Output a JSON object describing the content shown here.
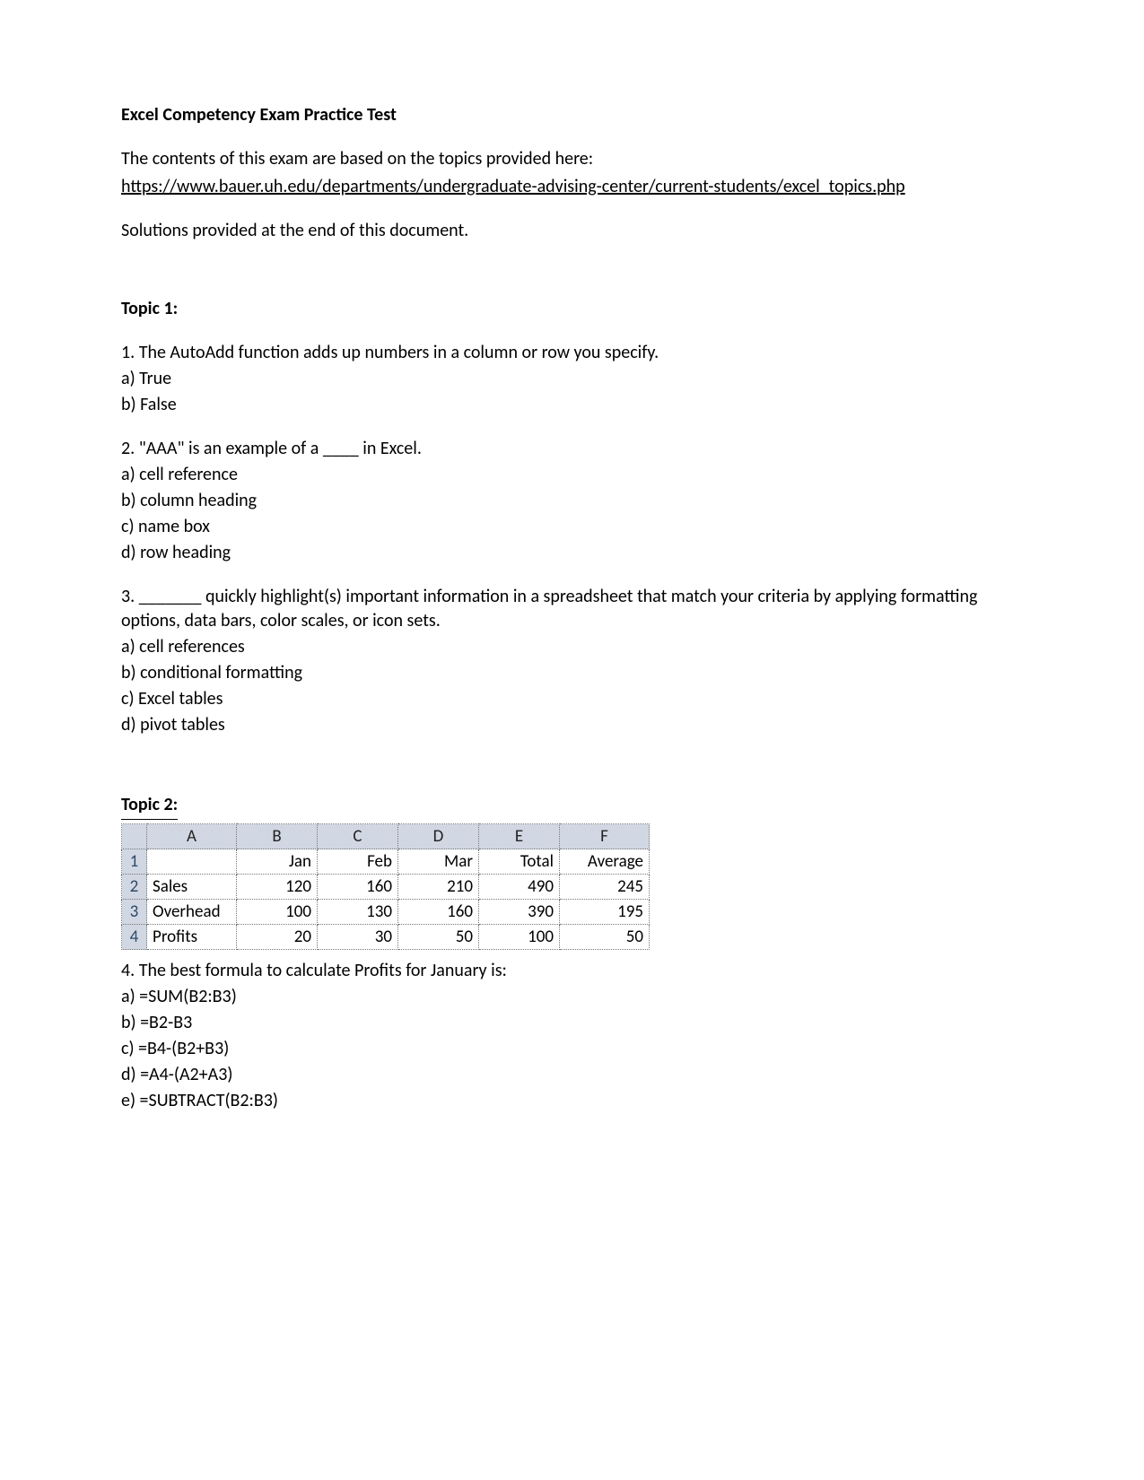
{
  "title": "Excel Competency Exam Practice Test",
  "intro": "The contents of this exam are based on the topics provided here:",
  "link": "https://www.bauer.uh.edu/departments/undergraduate-advising-center/current-students/excel_topics.php",
  "solutions_note": "Solutions provided at the end of this document.",
  "topic1": {
    "heading": "Topic 1:",
    "q1": {
      "stem": "1. The AutoAdd function adds up numbers in a column or row you specify.",
      "a": "a) True",
      "b": "b) False"
    },
    "q2": {
      "stem": "2. \"AAA\" is an example of a ____ in Excel.",
      "a": "a) cell reference",
      "b": "b) column heading",
      "c": "c) name box",
      "d": "d) row heading"
    },
    "q3": {
      "stem": "3. _______ quickly highlight(s) important information in a spreadsheet that match your criteria by applying formatting options, data bars, color scales, or icon sets.",
      "a": "a) cell references",
      "b": "b) conditional formatting",
      "c": "c) Excel tables",
      "d": "d) pivot tables"
    }
  },
  "topic2": {
    "heading": "Topic 2:",
    "table": {
      "columns": [
        "A",
        "B",
        "C",
        "D",
        "E",
        "F"
      ],
      "rownums": [
        "1",
        "2",
        "3",
        "4"
      ],
      "headerRow": {
        "A": "",
        "B": "Jan",
        "C": "Feb",
        "D": "Mar",
        "E": "Total",
        "F": "Average"
      },
      "rows": [
        {
          "label": "Sales",
          "B": "120",
          "C": "160",
          "D": "210",
          "E": "490",
          "F": "245"
        },
        {
          "label": "Overhead",
          "B": "100",
          "C": "130",
          "D": "160",
          "E": "390",
          "F": "195"
        },
        {
          "label": "Profits",
          "B": "20",
          "C": "30",
          "D": "50",
          "E": "100",
          "F": "50"
        }
      ]
    },
    "q4": {
      "stem": "4. The best formula to calculate Profits for January is:",
      "a": "a) =SUM(B2:B3)",
      "b": "b) =B2-B3",
      "c": "c) =B4-(B2+B3)",
      "d": "d) =A4-(A2+A3)",
      "e": "e) =SUBTRACT(B2:B3)"
    }
  },
  "chart_data": {
    "type": "table",
    "title": "Topic 2 spreadsheet",
    "columns": [
      "",
      "Jan",
      "Feb",
      "Mar",
      "Total",
      "Average"
    ],
    "rows": [
      [
        "Sales",
        120,
        160,
        210,
        490,
        245
      ],
      [
        "Overhead",
        100,
        130,
        160,
        390,
        195
      ],
      [
        "Profits",
        20,
        30,
        50,
        100,
        50
      ]
    ]
  }
}
